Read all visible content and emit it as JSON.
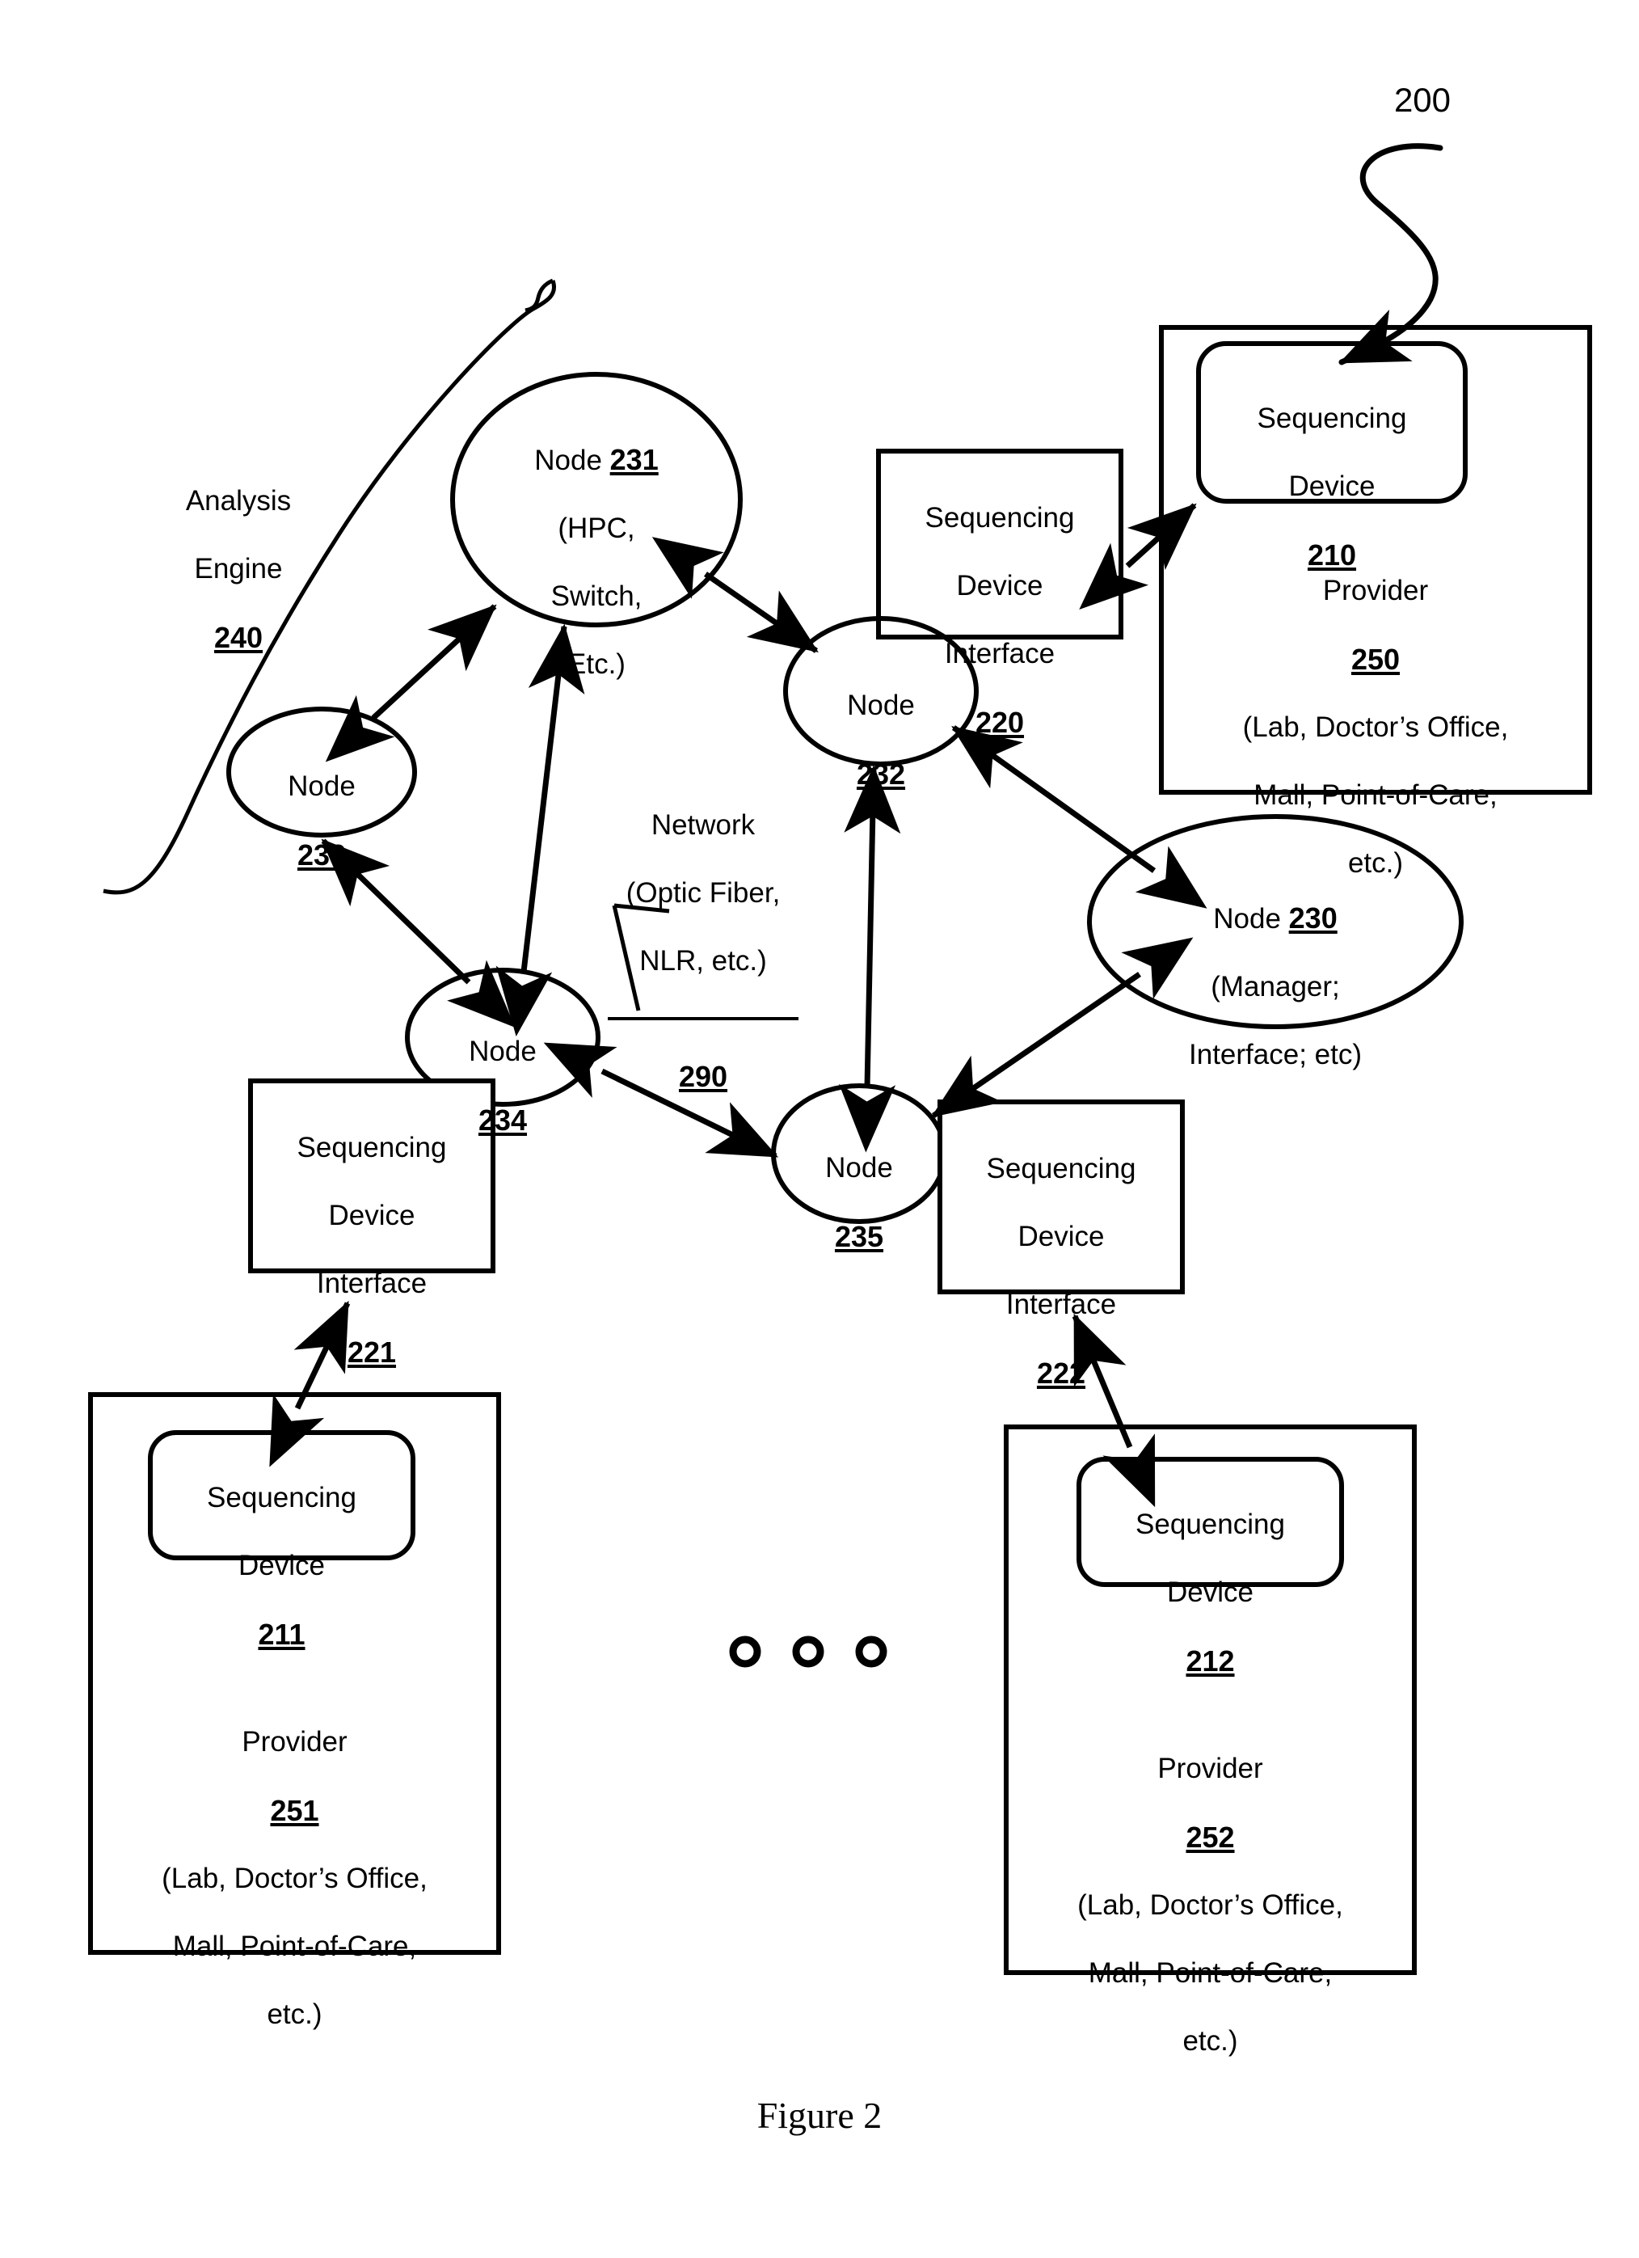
{
  "figure": {
    "caption": "Figure 2",
    "system_ref": "200"
  },
  "callouts": {
    "analysis_engine": {
      "line1": "Analysis",
      "line2": "Engine",
      "ref": "240"
    },
    "network": {
      "line1": "Network",
      "line2": "(Optic Fiber,",
      "line3": "NLR, etc.)",
      "ref": "290"
    }
  },
  "nodes": [
    {
      "id": "node-231",
      "label": "Node",
      "ref": "231",
      "detail_lines": [
        "(HPC,",
        "Switch,",
        "Etc.)"
      ]
    },
    {
      "id": "node-232",
      "label": "Node",
      "ref": "232",
      "detail_lines": []
    },
    {
      "id": "node-233",
      "label": "Node",
      "ref": "233",
      "detail_lines": []
    },
    {
      "id": "node-234",
      "label": "Node",
      "ref": "234",
      "detail_lines": []
    },
    {
      "id": "node-235",
      "label": "Node",
      "ref": "235",
      "detail_lines": []
    },
    {
      "id": "node-230",
      "label": "Node",
      "ref": "230",
      "detail_lines": [
        "(Manager;",
        "Interface; etc)"
      ]
    }
  ],
  "interfaces": [
    {
      "id": "sdi-220",
      "line1": "Sequencing",
      "line2": "Device",
      "line3": "Interface",
      "ref": "220"
    },
    {
      "id": "sdi-221",
      "line1": "Sequencing",
      "line2": "Device",
      "line3": "Interface",
      "ref": "221"
    },
    {
      "id": "sdi-222",
      "line1": "Sequencing",
      "line2": "Device",
      "line3": "Interface",
      "ref": "222"
    }
  ],
  "devices": [
    {
      "id": "device-210",
      "line1": "Sequencing",
      "line2": "Device",
      "ref": "210"
    },
    {
      "id": "device-211",
      "line1": "Sequencing",
      "line2": "Device",
      "ref": "211"
    },
    {
      "id": "device-212",
      "line1": "Sequencing",
      "line2": "Device",
      "ref": "212"
    }
  ],
  "providers": [
    {
      "id": "provider-250",
      "label": "Provider",
      "ref": "250",
      "detail_lines": [
        "(Lab, Doctor’s Office,",
        "Mall, Point-of-Care,",
        "etc.)"
      ]
    },
    {
      "id": "provider-251",
      "label": "Provider",
      "ref": "251",
      "detail_lines": [
        "(Lab, Doctor’s Office,",
        "Mall, Point-of-Care,",
        "etc.)"
      ]
    },
    {
      "id": "provider-252",
      "label": "Provider",
      "ref": "252",
      "detail_lines": [
        "(Lab, Doctor’s Office,",
        "Mall, Point-of-Care,",
        "etc.)"
      ]
    }
  ],
  "ellipsis_marker": {
    "symbol": "o o o",
    "count": 3
  },
  "colors": {
    "stroke": "#000000",
    "background": "#ffffff"
  }
}
